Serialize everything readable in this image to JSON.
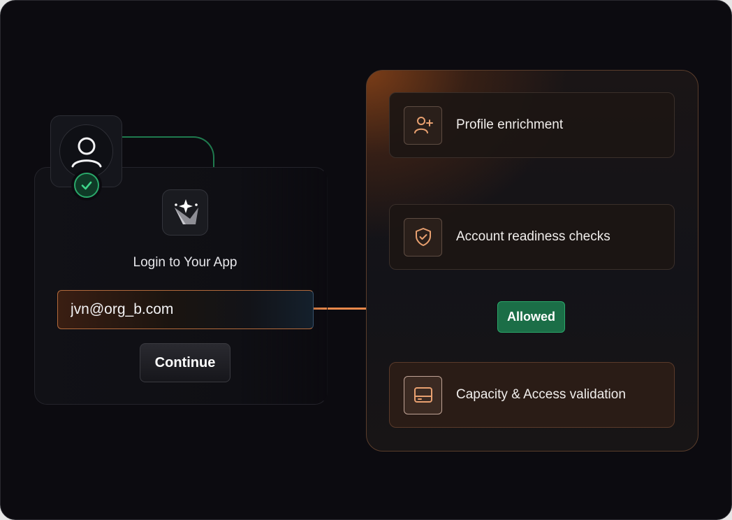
{
  "login": {
    "title": "Login to Your App",
    "email_value": "jvn@org_b.com",
    "continue_label": "Continue",
    "avatar_status": "verified"
  },
  "workflow": {
    "steps": [
      {
        "label": "Profile enrichment",
        "icon": "user-plus-icon"
      },
      {
        "label": "Account readiness checks",
        "icon": "shield-check-icon"
      },
      {
        "label": "Capacity & Access validation",
        "icon": "hard-drive-icon"
      }
    ],
    "status_badge": "Allowed"
  },
  "colors": {
    "background": "#0c0b10",
    "accent_orange": "#e8884a",
    "success_green": "#1b6e47",
    "success_border": "#2aa86a",
    "icon_orange": "#e8a070"
  }
}
